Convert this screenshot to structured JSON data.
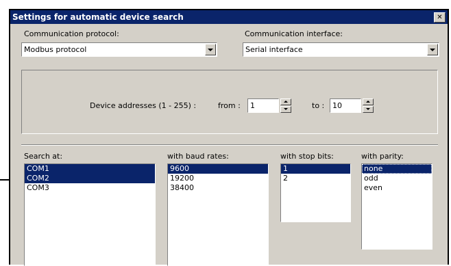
{
  "window": {
    "title": "Settings for automatic device search",
    "close_glyph": "✕"
  },
  "protocol": {
    "label": "Communication protocol:",
    "value": "Modbus protocol"
  },
  "interface": {
    "label": "Communication interface:",
    "value": "Serial interface"
  },
  "addresses": {
    "label": "Device addresses (1 - 255) :",
    "from_label": "from :",
    "from_value": "1",
    "to_label": "to :",
    "to_value": "10"
  },
  "search_at": {
    "label": "Search at:",
    "items": [
      "COM1",
      "COM2",
      "COM3"
    ],
    "selected": [
      "COM1",
      "COM2"
    ]
  },
  "baud": {
    "label": "with baud rates:",
    "items": [
      "9600",
      "19200",
      "38400"
    ],
    "selected": [
      "9600"
    ]
  },
  "stop_bits": {
    "label": "with stop bits:",
    "items": [
      "1",
      "2"
    ],
    "selected": [
      "1"
    ]
  },
  "parity": {
    "label": "with parity:",
    "items": [
      "none",
      "odd",
      "even"
    ],
    "selected": [
      "none"
    ]
  },
  "colors": {
    "title_bar": "#0a246a",
    "selection": "#0a246a",
    "face": "#d4d0c8"
  }
}
